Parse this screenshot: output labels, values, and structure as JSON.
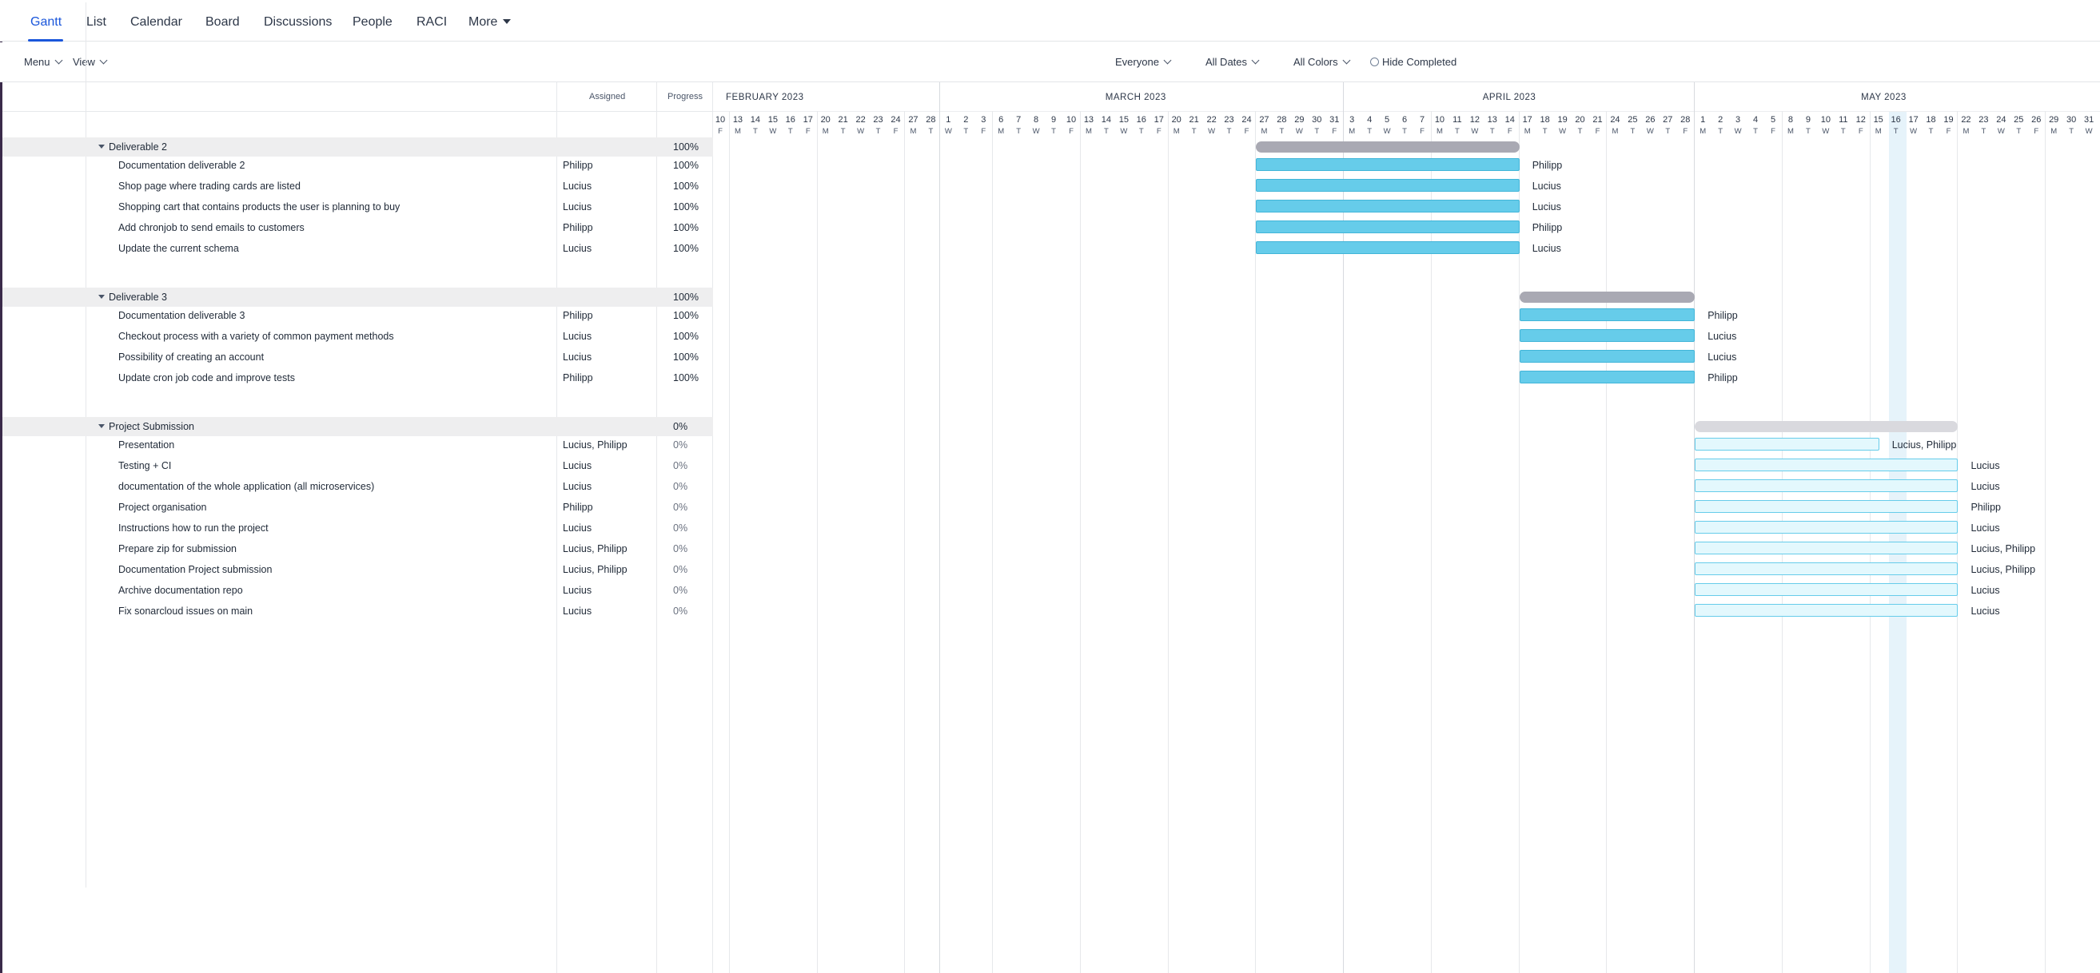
{
  "tabs": [
    "Gantt",
    "List",
    "Calendar",
    "Board",
    "Discussions",
    "People",
    "RACI",
    "More"
  ],
  "toolbar": {
    "menu": "Menu",
    "view": "View",
    "filter_people": "Everyone",
    "filter_dates": "All Dates",
    "filter_colors": "All Colors",
    "hide_completed": "Hide Completed"
  },
  "columns": {
    "assigned": "Assigned",
    "progress": "Progress"
  },
  "timeline": {
    "months": [
      "FEBRUARY 2023",
      "MARCH 2023",
      "APRIL 2023",
      "MAY 2023"
    ],
    "days": [
      {
        "d": "10",
        "w": "F"
      },
      {
        "d": "13",
        "w": "M"
      },
      {
        "d": "14",
        "w": "T"
      },
      {
        "d": "15",
        "w": "W"
      },
      {
        "d": "16",
        "w": "T"
      },
      {
        "d": "17",
        "w": "F"
      },
      {
        "d": "20",
        "w": "M"
      },
      {
        "d": "21",
        "w": "T"
      },
      {
        "d": "22",
        "w": "W"
      },
      {
        "d": "23",
        "w": "T"
      },
      {
        "d": "24",
        "w": "F"
      },
      {
        "d": "27",
        "w": "M"
      },
      {
        "d": "28",
        "w": "T"
      },
      {
        "d": "1",
        "w": "W"
      },
      {
        "d": "2",
        "w": "T"
      },
      {
        "d": "3",
        "w": "F"
      },
      {
        "d": "6",
        "w": "M"
      },
      {
        "d": "7",
        "w": "T"
      },
      {
        "d": "8",
        "w": "W"
      },
      {
        "d": "9",
        "w": "T"
      },
      {
        "d": "10",
        "w": "F"
      },
      {
        "d": "13",
        "w": "M"
      },
      {
        "d": "14",
        "w": "T"
      },
      {
        "d": "15",
        "w": "W"
      },
      {
        "d": "16",
        "w": "T"
      },
      {
        "d": "17",
        "w": "F"
      },
      {
        "d": "20",
        "w": "M"
      },
      {
        "d": "21",
        "w": "T"
      },
      {
        "d": "22",
        "w": "W"
      },
      {
        "d": "23",
        "w": "T"
      },
      {
        "d": "24",
        "w": "F"
      },
      {
        "d": "27",
        "w": "M"
      },
      {
        "d": "28",
        "w": "T"
      },
      {
        "d": "29",
        "w": "W"
      },
      {
        "d": "30",
        "w": "T"
      },
      {
        "d": "31",
        "w": "F"
      },
      {
        "d": "3",
        "w": "M"
      },
      {
        "d": "4",
        "w": "T"
      },
      {
        "d": "5",
        "w": "W"
      },
      {
        "d": "6",
        "w": "T"
      },
      {
        "d": "7",
        "w": "F"
      },
      {
        "d": "10",
        "w": "M"
      },
      {
        "d": "11",
        "w": "T"
      },
      {
        "d": "12",
        "w": "W"
      },
      {
        "d": "13",
        "w": "T"
      },
      {
        "d": "14",
        "w": "F"
      },
      {
        "d": "17",
        "w": "M"
      },
      {
        "d": "18",
        "w": "T"
      },
      {
        "d": "19",
        "w": "W"
      },
      {
        "d": "20",
        "w": "T"
      },
      {
        "d": "21",
        "w": "F"
      },
      {
        "d": "24",
        "w": "M"
      },
      {
        "d": "25",
        "w": "T"
      },
      {
        "d": "26",
        "w": "W"
      },
      {
        "d": "27",
        "w": "T"
      },
      {
        "d": "28",
        "w": "F"
      },
      {
        "d": "1",
        "w": "M"
      },
      {
        "d": "2",
        "w": "T"
      },
      {
        "d": "3",
        "w": "W"
      },
      {
        "d": "4",
        "w": "T"
      },
      {
        "d": "5",
        "w": "F"
      },
      {
        "d": "8",
        "w": "M"
      },
      {
        "d": "9",
        "w": "T"
      },
      {
        "d": "10",
        "w": "W"
      },
      {
        "d": "11",
        "w": "T"
      },
      {
        "d": "12",
        "w": "F"
      },
      {
        "d": "15",
        "w": "M"
      },
      {
        "d": "16",
        "w": "T"
      },
      {
        "d": "17",
        "w": "W"
      },
      {
        "d": "18",
        "w": "T"
      },
      {
        "d": "19",
        "w": "F"
      },
      {
        "d": "22",
        "w": "M"
      },
      {
        "d": "23",
        "w": "T"
      },
      {
        "d": "24",
        "w": "W"
      },
      {
        "d": "25",
        "w": "T"
      },
      {
        "d": "26",
        "w": "F"
      },
      {
        "d": "29",
        "w": "M"
      },
      {
        "d": "30",
        "w": "T"
      },
      {
        "d": "31",
        "w": "W"
      }
    ]
  },
  "groups": [
    {
      "name": "Deliverable 2",
      "progress": "100%",
      "status": "done",
      "tasks": [
        {
          "name": "Documentation deliverable 2",
          "assigned": "Philipp",
          "progress": "100%"
        },
        {
          "name": "Shop page where trading cards are listed",
          "assigned": "Lucius",
          "progress": "100%"
        },
        {
          "name": "Shopping cart that contains products the user is planning to buy",
          "assigned": "Lucius",
          "progress": "100%"
        },
        {
          "name": "Add chronjob to send emails to customers",
          "assigned": "Philipp",
          "progress": "100%"
        },
        {
          "name": "Update the current schema",
          "assigned": "Lucius",
          "progress": "100%"
        }
      ]
    },
    {
      "name": "Deliverable 3",
      "progress": "100%",
      "status": "done",
      "tasks": [
        {
          "name": "Documentation deliverable 3",
          "assigned": "Philipp",
          "progress": "100%"
        },
        {
          "name": "Checkout process with a variety of common payment methods",
          "assigned": "Lucius",
          "progress": "100%"
        },
        {
          "name": "Possibility of creating an account",
          "assigned": "Lucius",
          "progress": "100%"
        },
        {
          "name": "Update cron job code and improve tests",
          "assigned": "Philipp",
          "progress": "100%"
        }
      ]
    },
    {
      "name": "Project Submission",
      "progress": "0%",
      "status": "todo",
      "tasks": [
        {
          "name": "Presentation",
          "assigned": "Lucius, Philipp",
          "progress": "0%"
        },
        {
          "name": "Testing + CI",
          "assigned": "Lucius",
          "progress": "0%"
        },
        {
          "name": "documentation of the whole application (all microservices)",
          "assigned": "Lucius",
          "progress": "0%"
        },
        {
          "name": "Project organisation",
          "assigned": "Philipp",
          "progress": "0%"
        },
        {
          "name": "Instructions how to run the project",
          "assigned": "Lucius",
          "progress": "0%"
        },
        {
          "name": "Prepare zip for submission",
          "assigned": "Lucius, Philipp",
          "progress": "0%"
        },
        {
          "name": "Documentation Project submission",
          "assigned": "Lucius, Philipp",
          "progress": "0%"
        },
        {
          "name": "Archive documentation repo",
          "assigned": "Lucius",
          "progress": "0%"
        },
        {
          "name": "Fix sonarcloud issues on main",
          "assigned": "Lucius",
          "progress": "0%"
        }
      ]
    }
  ],
  "colors": {
    "accent": "#1a56db",
    "bar_done": "#66ccea",
    "bar_todo": "#e3f8fd",
    "summary_done": "#a9a9b3",
    "summary_todo": "#d9d9de",
    "today": "#e6f3fa"
  }
}
